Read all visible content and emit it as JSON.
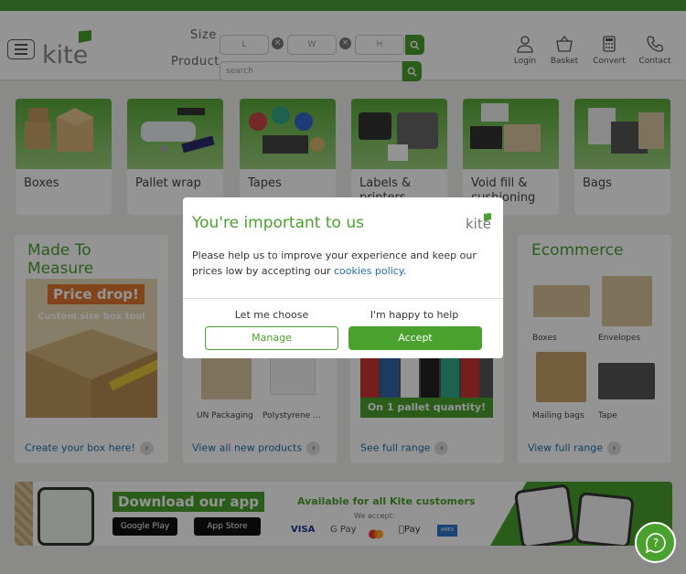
{
  "header": {
    "size_label": "Size",
    "product_label": "Product",
    "dims": [
      "L",
      "W",
      "H"
    ],
    "search_placeholder": "search",
    "logo": "kite",
    "nav": [
      "Login",
      "Basket",
      "Convert",
      "Contact"
    ]
  },
  "categories": [
    "Boxes",
    "Pallet wrap",
    "Tapes",
    "Labels & printers",
    "Void fill & cushioning",
    "Bags"
  ],
  "promo": {
    "mtm": {
      "title": "Made To Measure",
      "banner": "Price drop!",
      "sub": "Custom size box tool",
      "link": "Create your box here!"
    },
    "new": {
      "items": [
        "UN Packaging",
        "Polystyrene ..."
      ],
      "link": "View all new products"
    },
    "pallet": {
      "banner": "On 1 pallet quantity!",
      "link": "See full range"
    },
    "ecom": {
      "title": "Ecommerce",
      "items": [
        "Boxes",
        "Envelopes",
        "Mailing bags",
        "Tape"
      ],
      "link": "View full range"
    }
  },
  "app_banner": {
    "title": "Download our app",
    "google": "Google Play",
    "apple": "App Store",
    "available": "Available for all Kite customers",
    "accept": "We accept:",
    "cards": [
      "VISA",
      "G Pay",
      "mastercard",
      "Pay",
      "AMEX"
    ]
  },
  "modal": {
    "title": "You're important to us",
    "logo": "kite",
    "body": "Please help us to improve your experience and keep our prices low by accepting our ",
    "link": "cookies policy",
    "end": ".",
    "choose_caption": "Let me choose",
    "manage": "Manage",
    "help_caption": "I'm happy to help",
    "accept": "Accept"
  },
  "colors": {
    "brand": "#4aa12e",
    "link": "#1e6fa8"
  }
}
